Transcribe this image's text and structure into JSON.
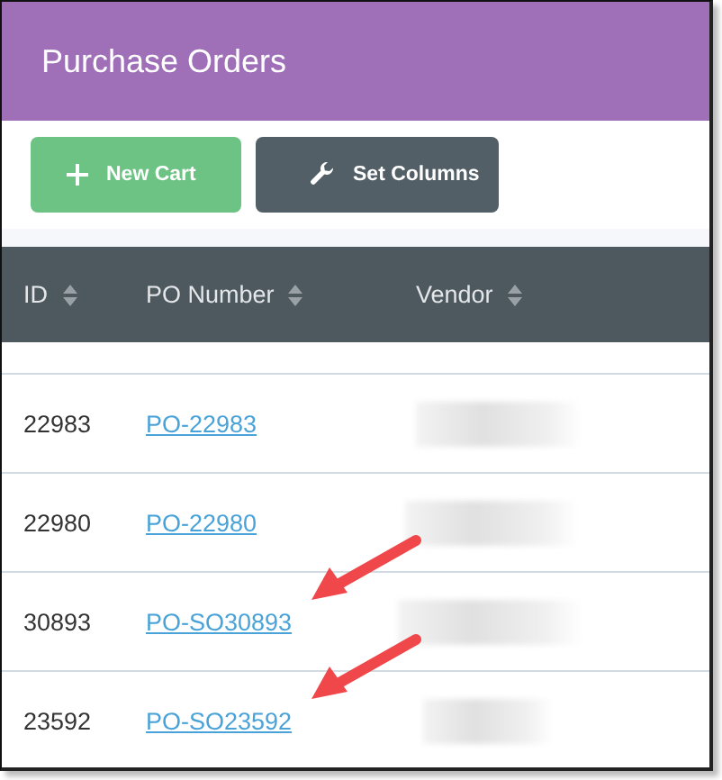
{
  "header": {
    "title": "Purchase Orders"
  },
  "buttons": [
    {
      "label": "New Cart",
      "kind": "primary"
    },
    {
      "label": "Set Columns",
      "kind": "secondary"
    }
  ],
  "table": {
    "columns": [
      {
        "label": "ID"
      },
      {
        "label": "PO Number"
      },
      {
        "label": "Vendor"
      }
    ],
    "rows": [
      {
        "id": "22983",
        "po_number": "PO-22983",
        "flagged": false
      },
      {
        "id": "22980",
        "po_number": "PO-22980",
        "flagged": false
      },
      {
        "id": "30893",
        "po_number": "PO-SO30893",
        "flagged": true
      },
      {
        "id": "23592",
        "po_number": "PO-SO23592",
        "flagged": true
      }
    ]
  }
}
